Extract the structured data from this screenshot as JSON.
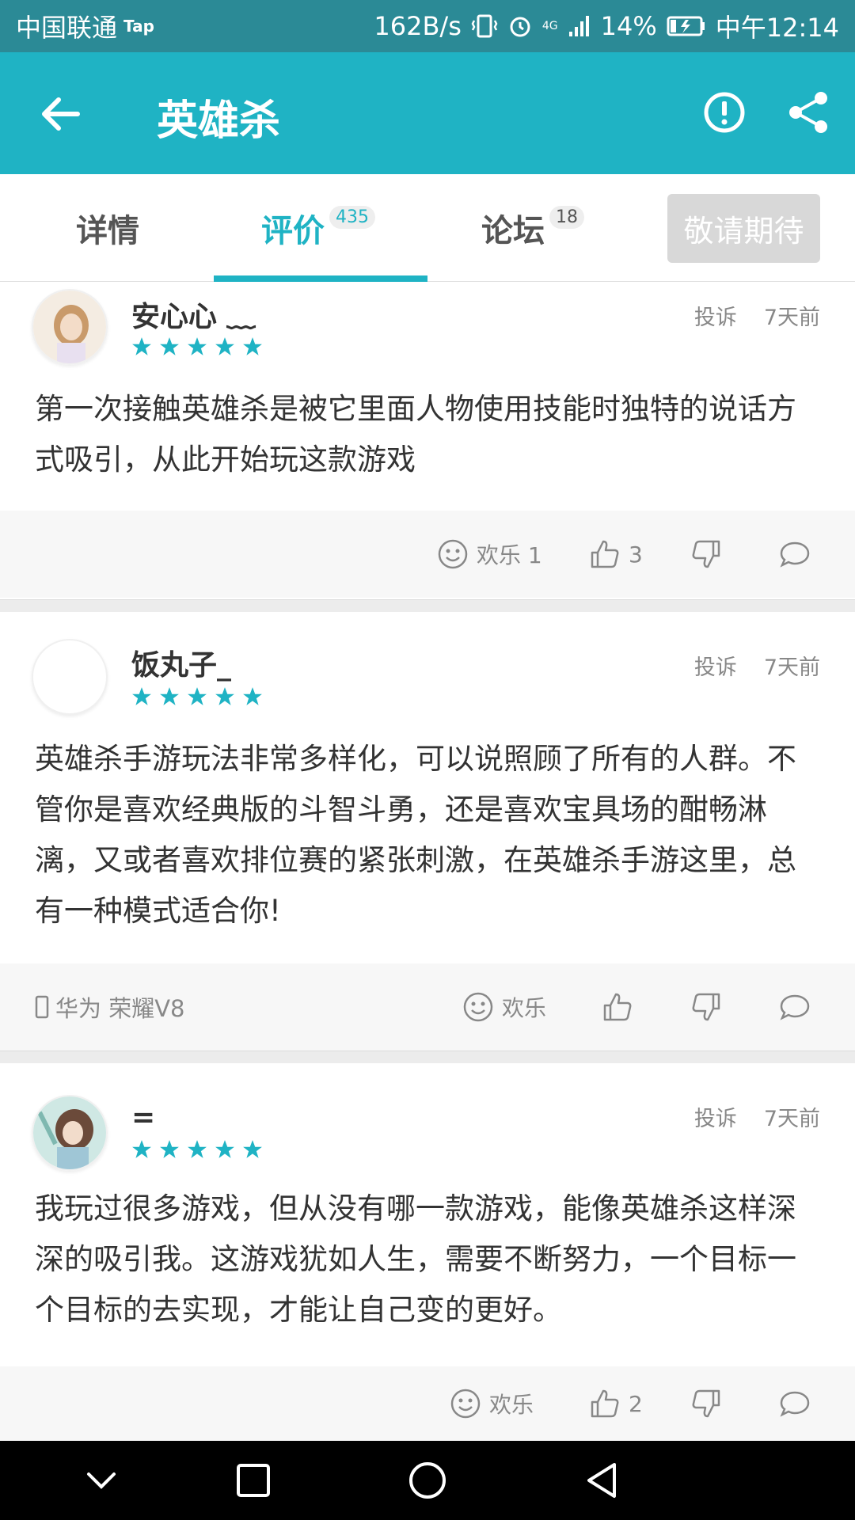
{
  "status_bar": {
    "carrier": "中国联通",
    "carrier_tag": "Tap",
    "speed": "162B/s",
    "network": "4G",
    "battery": "14%",
    "time": "中午12:14"
  },
  "app_bar": {
    "title": "英雄杀",
    "icons": [
      "back-arrow-icon",
      "alert-icon",
      "share-icon"
    ]
  },
  "tabs": [
    {
      "label": "详情",
      "badge": ""
    },
    {
      "label": "评价",
      "badge": "435"
    },
    {
      "label": "论坛",
      "badge": "18"
    }
  ],
  "expect_button": "敬请期待",
  "reviews": [
    {
      "name": "安心心 ﹏",
      "stars": 5,
      "report": "投诉",
      "time": "7天前",
      "content": "第一次接触英雄杀是被它里面人物使用技能时独特的说话方式吸引，从此开始玩这款游戏",
      "device": "",
      "happy_label": "欢乐 1",
      "likes": "3"
    },
    {
      "name": "饭丸子_",
      "stars": 5,
      "report": "投诉",
      "time": "7天前",
      "content": "英雄杀手游玩法非常多样化，可以说照顾了所有的人群。不管你是喜欢经典版的斗智斗勇，还是喜欢宝具场的酣畅淋漓，又或者喜欢排位赛的紧张刺激，在英雄杀手游这里，总有一种模式适合你!",
      "device": "华为 荣耀V8",
      "happy_label": "欢乐",
      "likes": ""
    },
    {
      "name": "=",
      "stars": 5,
      "report": "投诉",
      "time": "7天前",
      "content": "我玩过很多游戏，但从没有哪一款游戏，能像英雄杀这样深深的吸引我。这游戏犹如人生，需要不断努力，一个目标一个目标的去实现，才能让自己变的更好。",
      "device": "",
      "happy_label": "欢乐",
      "likes": "2"
    }
  ],
  "colors": {
    "accent": "#1fb3c4",
    "status_bar": "#2b8a96",
    "star": "#1fb3c4"
  }
}
